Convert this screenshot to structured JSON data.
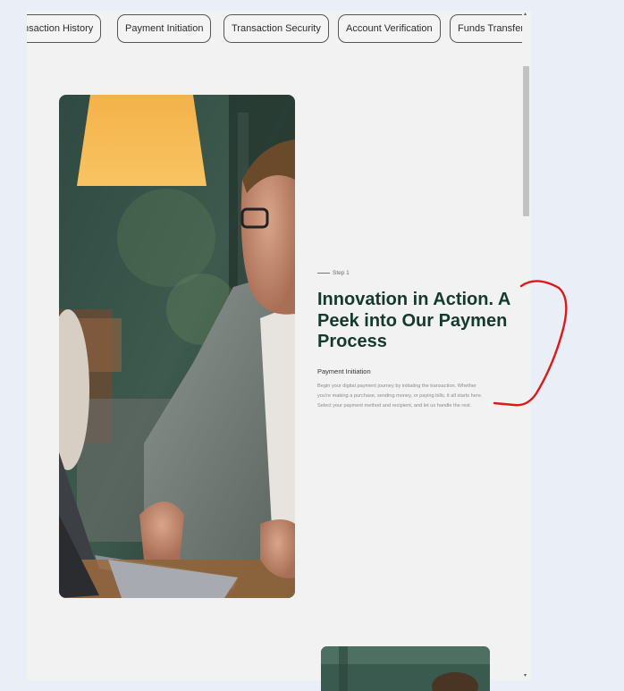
{
  "tabs": [
    "nsaction History",
    "Payment Initiation",
    "Transaction Security",
    "Account Verification",
    "Funds Transfer"
  ],
  "step_label": "Step 1",
  "headline": "Innovation in Action. A\nPeek into Our Paymen\nProcess",
  "subtitle": "Payment Initiation",
  "description": "Begin your digital payment journey by initiating the transaction. Whether you're making a purchase, sending money, or paying bills, it all starts here. Select your payment method and recipient, and let us handle the rest.",
  "colors": {
    "headline": "#143a2c",
    "annotation": "#e01818"
  },
  "scroll_arrows": {
    "up": "▴",
    "down": "▾"
  }
}
